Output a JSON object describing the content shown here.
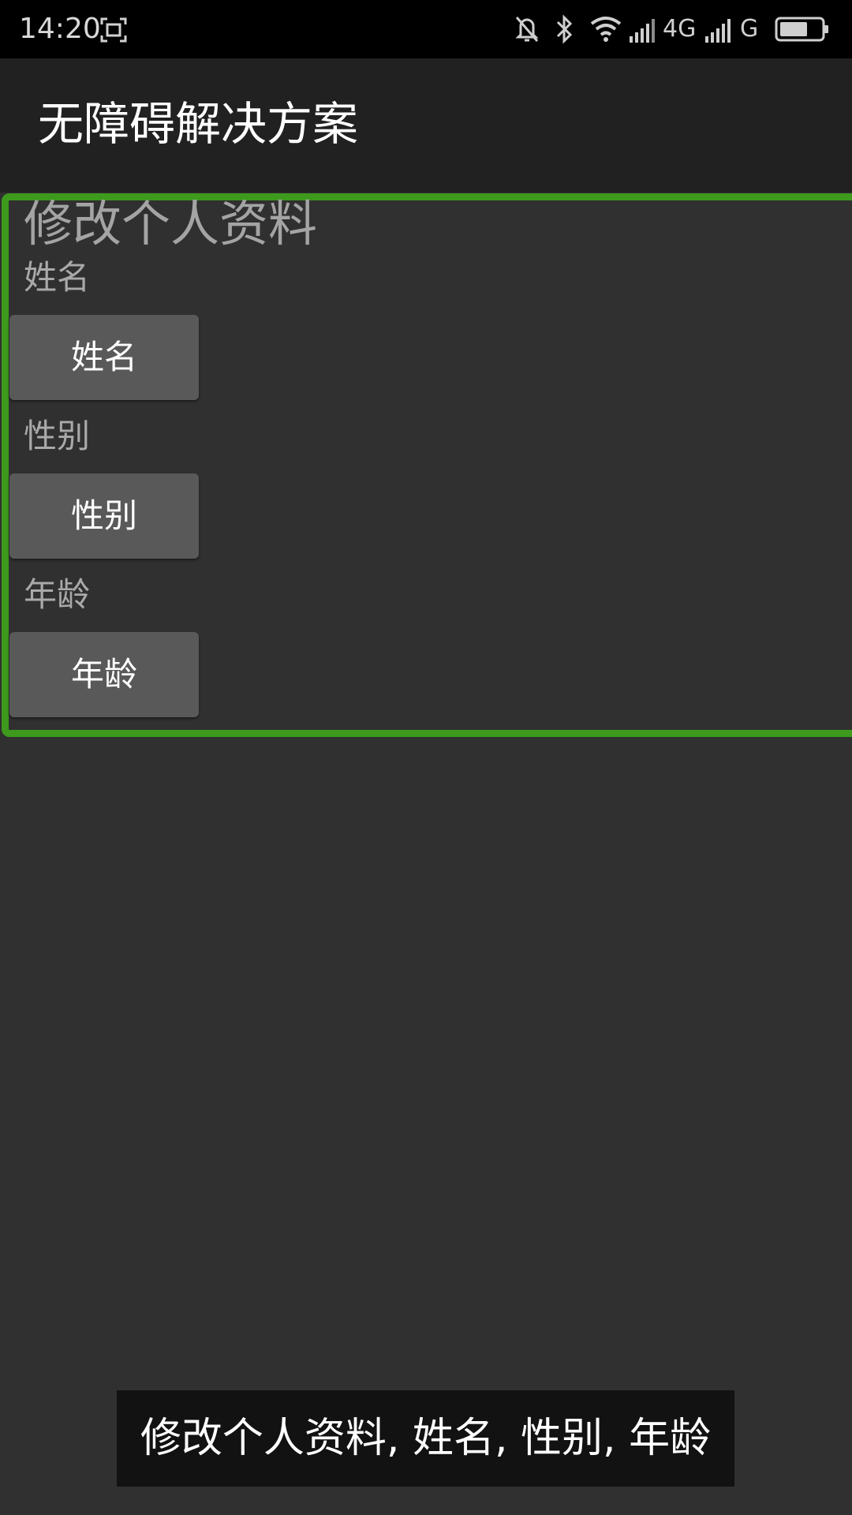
{
  "status_bar": {
    "time": "14:20",
    "network_1": "4G",
    "network_2": "G",
    "icons": [
      "screenshot-icon",
      "bell-off-icon",
      "bluetooth-icon",
      "wifi-icon",
      "signal-icon",
      "signal-icon",
      "battery-icon"
    ]
  },
  "app_bar": {
    "title": "无障碍解决方案"
  },
  "form": {
    "title": "修改个人资料",
    "fields": [
      {
        "label": "姓名",
        "button": "姓名"
      },
      {
        "label": "性别",
        "button": "性别"
      },
      {
        "label": "年龄",
        "button": "年龄"
      }
    ]
  },
  "caption": {
    "text": "修改个人资料, 姓名, 性别, 年龄"
  },
  "colors": {
    "focus_outline": "#3d9a1c",
    "background": "#303030",
    "app_bar": "#212121"
  }
}
